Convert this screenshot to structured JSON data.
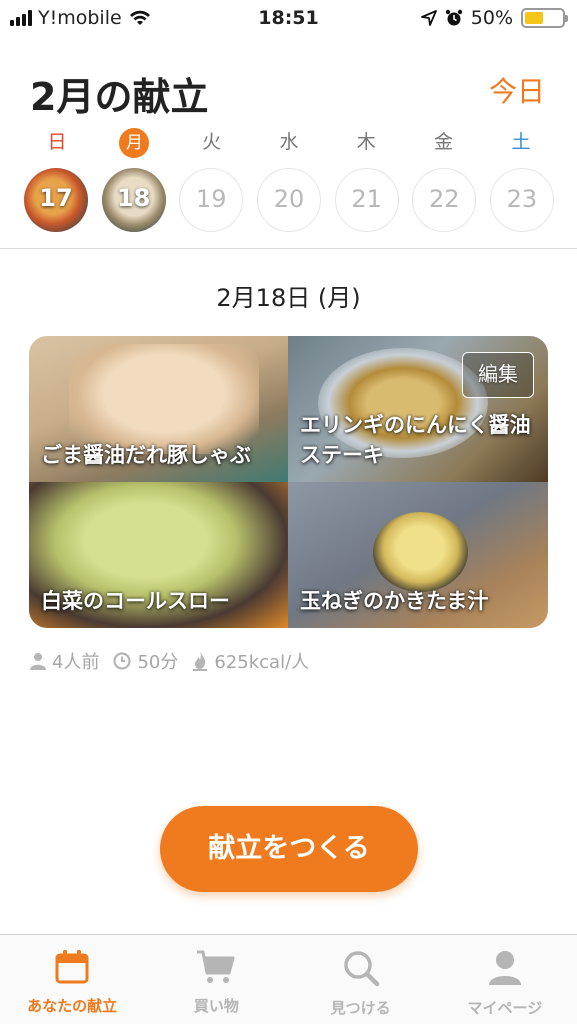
{
  "status_bar": {
    "carrier": "Y!mobile",
    "time": "18:51",
    "battery": "50%",
    "battery_level": 0.5,
    "battery_color": "#f5c518"
  },
  "header": {
    "title": "2月の献立",
    "today_label": "今日"
  },
  "week": {
    "weekdays": [
      "日",
      "月",
      "火",
      "水",
      "木",
      "金",
      "土"
    ],
    "days": [
      "17",
      "18",
      "19",
      "20",
      "21",
      "22",
      "23"
    ],
    "selected_index": 1
  },
  "selected_date": "2月18日 (月)",
  "menu": {
    "edit_label": "編集",
    "dishes": [
      {
        "name": "ごま醤油だれ豚しゃぶ"
      },
      {
        "name": "エリンギのにんにく醤油ステーキ"
      },
      {
        "name": "白菜のコールスロー"
      },
      {
        "name": "玉ねぎのかきたま汁"
      }
    ]
  },
  "meta": {
    "servings": "4人前",
    "time": "50分",
    "calories": "625kcal/人",
    "icons": [
      "person-icon",
      "clock-icon",
      "flame-icon"
    ]
  },
  "create_button": "献立をつくる",
  "tabs": [
    {
      "label": "あなたの献立",
      "icon": "calendar-icon"
    },
    {
      "label": "買い物",
      "icon": "cart-icon"
    },
    {
      "label": "見つける",
      "icon": "search-icon"
    },
    {
      "label": "マイページ",
      "icon": "user-icon"
    }
  ],
  "colors": {
    "accent": "#f07a1e",
    "sunday": "#e2462f",
    "saturday": "#3a8fd8",
    "muted": "#a6a6a6"
  }
}
